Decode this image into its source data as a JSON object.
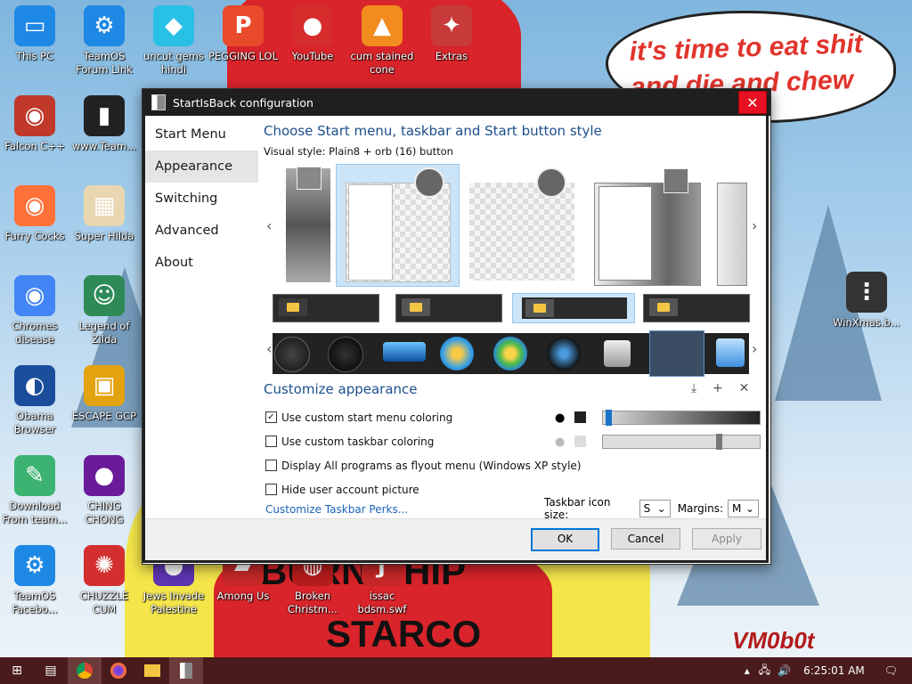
{
  "wallpaper": {
    "speech_bubble": "it's time to eat shit and die and chew nes",
    "big_text_1": "BURN SHIP",
    "big_text_2": "STARCO",
    "signature": "VM0b0t"
  },
  "desktop_icons": [
    {
      "label": "This PC",
      "icon": "monitor-icon",
      "color": "#1e88e5"
    },
    {
      "label": "TeamOS Forum Link",
      "icon": "gear-icon",
      "color": "#1e88e5"
    },
    {
      "label": "uncut gems hindi",
      "icon": "diamond-icon",
      "color": "#29c0e6"
    },
    {
      "label": "PEGGING LOL",
      "icon": "peggle-icon",
      "color": "#e84a2b"
    },
    {
      "label": "YouTube",
      "icon": "angry-bird-icon",
      "color": "#d62c2c"
    },
    {
      "label": "cum stained cone",
      "icon": "cone-icon",
      "color": "#f28c1e"
    },
    {
      "label": "Extras",
      "icon": "extras-icon",
      "color": "#c83a3a"
    },
    {
      "label": "Falcon C++",
      "icon": "falcon-icon",
      "color": "#c0392b"
    },
    {
      "label": "www.Team...",
      "icon": "book-icon",
      "color": "#222"
    },
    {
      "label": "Furry Cocks",
      "icon": "firefox-icon",
      "color": "#ff7139"
    },
    {
      "label": "Super Hilda",
      "icon": "pixel-art-icon",
      "color": "#e8d7b0"
    },
    {
      "label": "Chromes disease",
      "icon": "chrome-icon",
      "color": "#4285f4"
    },
    {
      "label": "Legend of Zilda",
      "icon": "zelda-icon",
      "color": "#2e8b57"
    },
    {
      "label": "Obama Browser",
      "icon": "obama-logo-icon",
      "color": "#1a4d9a"
    },
    {
      "label": "ESCAPE GCP",
      "icon": "mahjong-icon",
      "color": "#e3a20f"
    },
    {
      "label": "Download From team...",
      "icon": "notepad-icon",
      "color": "#3cb371"
    },
    {
      "label": "CHING CHONG",
      "icon": "orb-icon",
      "color": "#6a1b9a"
    },
    {
      "label": "TeamOS Facebo...",
      "icon": "gear-icon",
      "color": "#1e88e5"
    },
    {
      "label": "CHUZZLE CUM",
      "icon": "chuzzle-icon",
      "color": "#d32f2f"
    },
    {
      "label": "Jews Invade Palestine",
      "icon": "orb-icon",
      "color": "#5e35b1"
    },
    {
      "label": "Among Us",
      "icon": "among-us-icon",
      "color": "#c62828"
    },
    {
      "label": "Broken Christm...",
      "icon": "broken-icon",
      "color": "#b71c1c"
    },
    {
      "label": "issac bdsm.swf",
      "icon": "flash-icon",
      "color": "#c62828"
    },
    {
      "label": "WinXmas.b...",
      "icon": "traffic-light-icon",
      "color": "#333"
    }
  ],
  "dialog": {
    "title": "StartIsBack configuration",
    "nav": [
      "Start Menu",
      "Appearance",
      "Switching",
      "Advanced",
      "About"
    ],
    "active_nav": "Appearance",
    "heading": "Choose Start menu, taskbar and Start button style",
    "visual_style_label": "Visual style:",
    "visual_style_value": "Plain8 + orb (16) button",
    "section_customize": "Customize appearance",
    "checkboxes": [
      {
        "label": "Use custom start menu coloring",
        "checked": true
      },
      {
        "label": "Use custom taskbar coloring",
        "checked": false
      },
      {
        "label": "Display All programs as flyout menu (Windows XP style)",
        "checked": false
      },
      {
        "label": "Hide user account picture",
        "checked": false
      }
    ],
    "link": "Customize Taskbar Perks...",
    "taskbar_icon_size_label": "Taskbar icon size:",
    "taskbar_icon_size_value": "S",
    "margins_label": "Margins:",
    "margins_value": "M",
    "start_menu_color_slider": 0.02,
    "taskbar_color_slider": 0.75,
    "buttons": {
      "ok": "OK",
      "cancel": "Cancel",
      "apply": "Apply"
    }
  },
  "taskbar": {
    "clock": "6:25:01 AM",
    "items": [
      "start-icon",
      "task-view-icon",
      "chrome-icon",
      "firefox-icon",
      "file-explorer-icon",
      "startisback-icon"
    ]
  },
  "colors": {
    "accent": "#1d4f8c",
    "link": "#1a63b8",
    "taskbar": "#4a1b1c",
    "close": "#e81123"
  }
}
